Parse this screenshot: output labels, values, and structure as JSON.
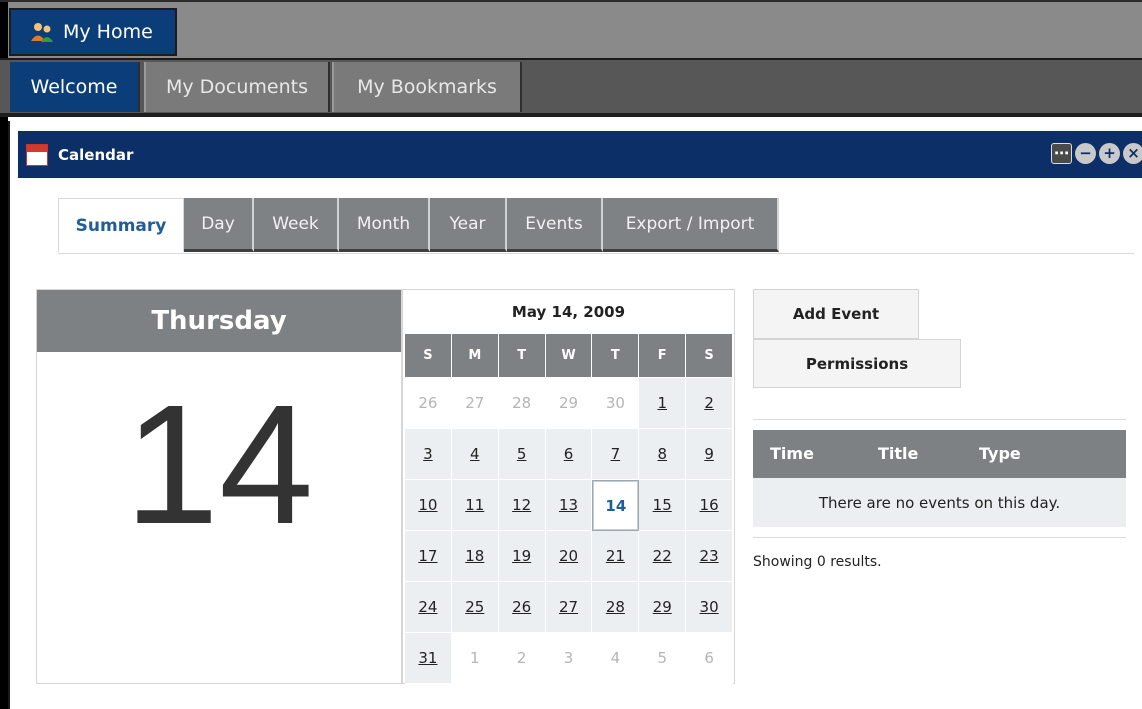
{
  "top_nav": {
    "home_label": "My Home"
  },
  "sub_nav": {
    "tabs": [
      "Welcome",
      "My Documents",
      "My Bookmarks"
    ],
    "active": "Welcome"
  },
  "portlet": {
    "title": "Calendar",
    "controls": [
      "options-icon",
      "minimize-icon",
      "maximize-icon",
      "close-icon"
    ]
  },
  "calendar_tabs": [
    "Summary",
    "Day",
    "Week",
    "Month",
    "Year",
    "Events",
    "Export / Import"
  ],
  "active_calendar_tab": "Summary",
  "day_panel": {
    "weekday": "Thursday",
    "day_number": "14"
  },
  "mini_calendar": {
    "title": "May 14, 2009",
    "weekday_headers": [
      "S",
      "M",
      "T",
      "W",
      "T",
      "F",
      "S"
    ],
    "weeks": [
      [
        {
          "d": "26",
          "o": true
        },
        {
          "d": "27",
          "o": true
        },
        {
          "d": "28",
          "o": true
        },
        {
          "d": "29",
          "o": true
        },
        {
          "d": "30",
          "o": true
        },
        {
          "d": "1"
        },
        {
          "d": "2"
        }
      ],
      [
        {
          "d": "3"
        },
        {
          "d": "4"
        },
        {
          "d": "5"
        },
        {
          "d": "6"
        },
        {
          "d": "7"
        },
        {
          "d": "8"
        },
        {
          "d": "9"
        }
      ],
      [
        {
          "d": "10"
        },
        {
          "d": "11"
        },
        {
          "d": "12"
        },
        {
          "d": "13"
        },
        {
          "d": "14",
          "s": true
        },
        {
          "d": "15"
        },
        {
          "d": "16"
        }
      ],
      [
        {
          "d": "17"
        },
        {
          "d": "18"
        },
        {
          "d": "19"
        },
        {
          "d": "20"
        },
        {
          "d": "21"
        },
        {
          "d": "22"
        },
        {
          "d": "23"
        }
      ],
      [
        {
          "d": "24"
        },
        {
          "d": "25"
        },
        {
          "d": "26"
        },
        {
          "d": "27"
        },
        {
          "d": "28"
        },
        {
          "d": "29"
        },
        {
          "d": "30"
        }
      ],
      [
        {
          "d": "31"
        },
        {
          "d": "1",
          "o": true
        },
        {
          "d": "2",
          "o": true
        },
        {
          "d": "3",
          "o": true
        },
        {
          "d": "4",
          "o": true
        },
        {
          "d": "5",
          "o": true
        },
        {
          "d": "6",
          "o": true
        }
      ]
    ]
  },
  "actions": {
    "add_event": "Add Event",
    "permissions": "Permissions"
  },
  "events_table": {
    "columns": [
      "Time",
      "Title",
      "Type"
    ],
    "empty_message": "There are no events on this day."
  },
  "results_text": "Showing 0 results.",
  "colors": {
    "nav_blue": "#0b3d78",
    "header_blue": "#0b2f66",
    "gray_header": "#7d8184",
    "active_tab_text": "#1f5e96"
  }
}
